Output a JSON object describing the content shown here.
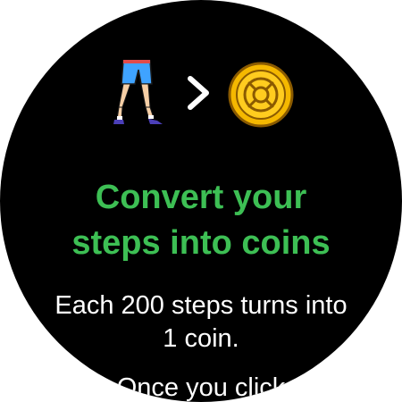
{
  "colors": {
    "accent": "#3dbf54",
    "text": "#ffffff",
    "background": "#000000",
    "coin": "#f5b800"
  },
  "icons": {
    "walking": "walking-legs-icon",
    "arrow": "chevron-right-icon",
    "coin": "coin-icon"
  },
  "title": {
    "line1": "Convert your",
    "line2": "steps into coins"
  },
  "description": {
    "line1": "Each 200 steps turns into",
    "line2": "1 coin."
  },
  "more_text": "Once you click"
}
